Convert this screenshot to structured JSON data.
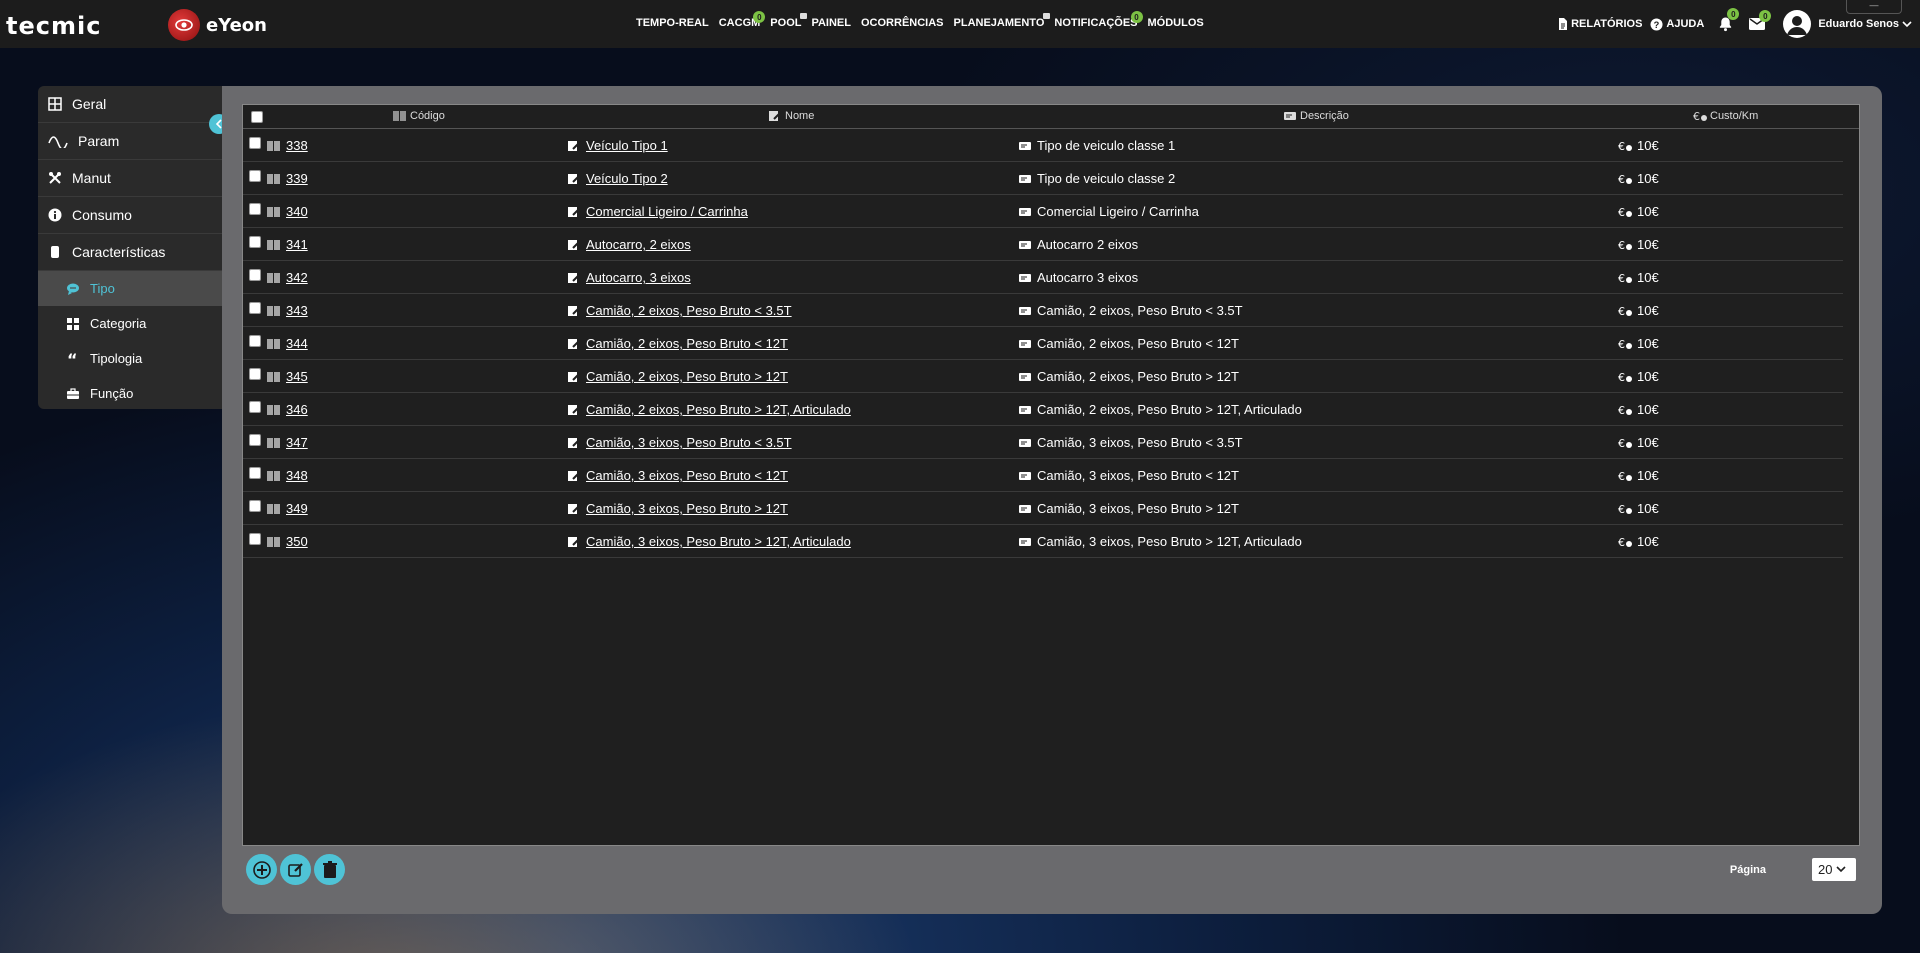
{
  "brand": {
    "logo_text": "tecmic",
    "product": "eYeon"
  },
  "nav": [
    {
      "label": "TEMPO-REAL",
      "badge": null,
      "lock": false
    },
    {
      "label": "CACGM",
      "badge": "0",
      "lock": false
    },
    {
      "label": "POOL",
      "badge": null,
      "lock": true
    },
    {
      "label": "PAINEL",
      "badge": null,
      "lock": false
    },
    {
      "label": "OCORRÊNCIAS",
      "badge": null,
      "lock": false
    },
    {
      "label": "PLANEJAMENTO",
      "badge": null,
      "lock": true
    },
    {
      "label": "NOTIFICAÇÕES",
      "badge": "0",
      "lock": false
    },
    {
      "label": "MÓDULOS",
      "badge": null,
      "lock": false
    }
  ],
  "topright": {
    "reports": "RELATÓRIOS",
    "help": "AJUDA",
    "bell_badge": "0",
    "mail_badge": "0",
    "user": "Eduardo Senos"
  },
  "sidebar": {
    "items": [
      "Geral",
      "Param",
      "Manut",
      "Consumo",
      "Características"
    ],
    "subitems": [
      "Tipo",
      "Categoria",
      "Tipologia",
      "Função"
    ]
  },
  "table": {
    "headers": [
      "Código",
      "Nome",
      "Descrição",
      "Custo/Km"
    ],
    "rows": [
      {
        "code": "338",
        "name": "Veículo Tipo 1",
        "desc": "Tipo de veiculo classe 1",
        "cost": "10€"
      },
      {
        "code": "339",
        "name": "Veículo Tipo 2",
        "desc": "Tipo de veiculo classe 2",
        "cost": "10€"
      },
      {
        "code": "340",
        "name": "Comercial Ligeiro / Carrinha",
        "desc": "Comercial Ligeiro / Carrinha",
        "cost": "10€"
      },
      {
        "code": "341",
        "name": "Autocarro, 2 eixos",
        "desc": "Autocarro 2 eixos",
        "cost": "10€"
      },
      {
        "code": "342",
        "name": "Autocarro, 3 eixos",
        "desc": "Autocarro 3 eixos",
        "cost": "10€"
      },
      {
        "code": "343",
        "name": "Camião, 2 eixos, Peso Bruto < 3.5T",
        "desc": "Camião, 2 eixos, Peso Bruto < 3.5T",
        "cost": "10€"
      },
      {
        "code": "344",
        "name": "Camião, 2 eixos, Peso Bruto < 12T",
        "desc": "Camião, 2 eixos, Peso Bruto < 12T",
        "cost": "10€"
      },
      {
        "code": "345",
        "name": "Camião, 2 eixos, Peso Bruto > 12T",
        "desc": "Camião, 2 eixos, Peso Bruto > 12T",
        "cost": "10€"
      },
      {
        "code": "346",
        "name": "Camião, 2 eixos, Peso Bruto > 12T, Articulado",
        "desc": "Camião, 2 eixos, Peso Bruto > 12T, Articulado",
        "cost": "10€"
      },
      {
        "code": "347",
        "name": "Camião, 3 eixos, Peso Bruto < 3.5T",
        "desc": "Camião, 3 eixos, Peso Bruto < 3.5T",
        "cost": "10€"
      },
      {
        "code": "348",
        "name": "Camião, 3 eixos, Peso Bruto < 12T",
        "desc": "Camião, 3 eixos, Peso Bruto < 12T",
        "cost": "10€"
      },
      {
        "code": "349",
        "name": "Camião, 3 eixos, Peso Bruto > 12T",
        "desc": "Camião, 3 eixos, Peso Bruto > 12T",
        "cost": "10€"
      },
      {
        "code": "350",
        "name": "Camião, 3 eixos, Peso Bruto > 12T, Articulado",
        "desc": "Camião, 3 eixos, Peso Bruto > 12T, Articulado",
        "cost": "10€"
      }
    ]
  },
  "footer": {
    "page_label": "Página",
    "page_size": "20"
  },
  "colors": {
    "accent": "#4fc3d6",
    "badge": "#7cc244",
    "topbar": "#1c1c1c"
  }
}
